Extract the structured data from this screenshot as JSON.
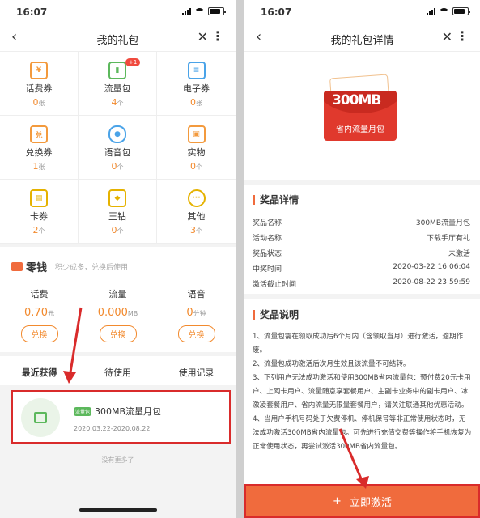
{
  "status": {
    "time": "16:07",
    "time_right": "16:07"
  },
  "left": {
    "title": "我的礼包",
    "grid": [
      {
        "icon": "ticket-icon",
        "label": "话费券",
        "count": "0",
        "unit": "张"
      },
      {
        "icon": "data-chart-icon",
        "label": "流量包",
        "count": "4",
        "unit": "个",
        "badge": "+1"
      },
      {
        "icon": "e-coupon-icon",
        "label": "电子券",
        "count": "0",
        "unit": "张"
      },
      {
        "icon": "exchange-ticket-icon",
        "label": "兑换券",
        "count": "1",
        "unit": "张"
      },
      {
        "icon": "microphone-icon",
        "label": "语音包",
        "count": "0",
        "unit": "个"
      },
      {
        "icon": "gift-box-icon",
        "label": "实物",
        "count": "0",
        "unit": "个"
      },
      {
        "icon": "card-bag-icon",
        "label": "卡券",
        "count": "2",
        "unit": "个"
      },
      {
        "icon": "diamond-icon",
        "label": "王钻",
        "count": "0",
        "unit": "个"
      },
      {
        "icon": "more-dots-icon",
        "label": "其他",
        "count": "3",
        "unit": "个"
      }
    ],
    "change": {
      "title": "零钱",
      "subtitle": "积少成多，兑换后使用",
      "items": [
        {
          "name": "话费",
          "value": "0.70",
          "unit": "元",
          "button": "兑换"
        },
        {
          "name": "流量",
          "value": "0.000",
          "unit": "MB",
          "button": "兑换"
        },
        {
          "name": "语音",
          "value": "0",
          "unit": "分钟",
          "button": "兑换"
        }
      ]
    },
    "tabs": [
      "最近获得",
      "待使用",
      "使用记录"
    ],
    "card": {
      "tag": "流量包",
      "title": "300MB流量月包",
      "date": "2020.03.22-2020.08.22"
    },
    "no_more": "没有更多了"
  },
  "right": {
    "title": "我的礼包详情",
    "hero": {
      "amount": "300MB",
      "name": "省内流量月包"
    },
    "detail_title": "奖品详情",
    "details": [
      {
        "k": "奖品名称",
        "v": "300MB流量月包"
      },
      {
        "k": "活动名称",
        "v": "下载手厅有礼"
      },
      {
        "k": "奖品状态",
        "v": "未激活"
      },
      {
        "k": "中奖时间",
        "v": "2020-03-22 16:06:04"
      },
      {
        "k": "激活截止时间",
        "v": "2020-08-22 23:59:59"
      }
    ],
    "explain_title": "奖品说明",
    "explain": [
      "1、流量包需在领取成功后6个月内（含领取当月）进行激活，逾期作废。",
      "2、流量包成功激活后次月生效且该流量不可结转。",
      "3、下列用户无法成功激活和使用300MB省内流量包：预付费20元卡用户、上网卡用户、流量随意享套餐用户、主副卡业务中的副卡用户、冰激凌套餐用户、省内流量无限量套餐用户，请关注联通其他优惠活动。",
      "4、当用户手机号码处于欠费停机、停机保号等非正常使用状态时，无法成功激活300MB省内流量包。可先进行充值交费等操作将手机恢复为正常使用状态，再尝试激活300MB省内流量包。"
    ],
    "cta": "立即激活"
  },
  "colors": {
    "accent": "#f06b3d",
    "highlight": "#d92b2b",
    "orange_text": "#f28a2e"
  }
}
